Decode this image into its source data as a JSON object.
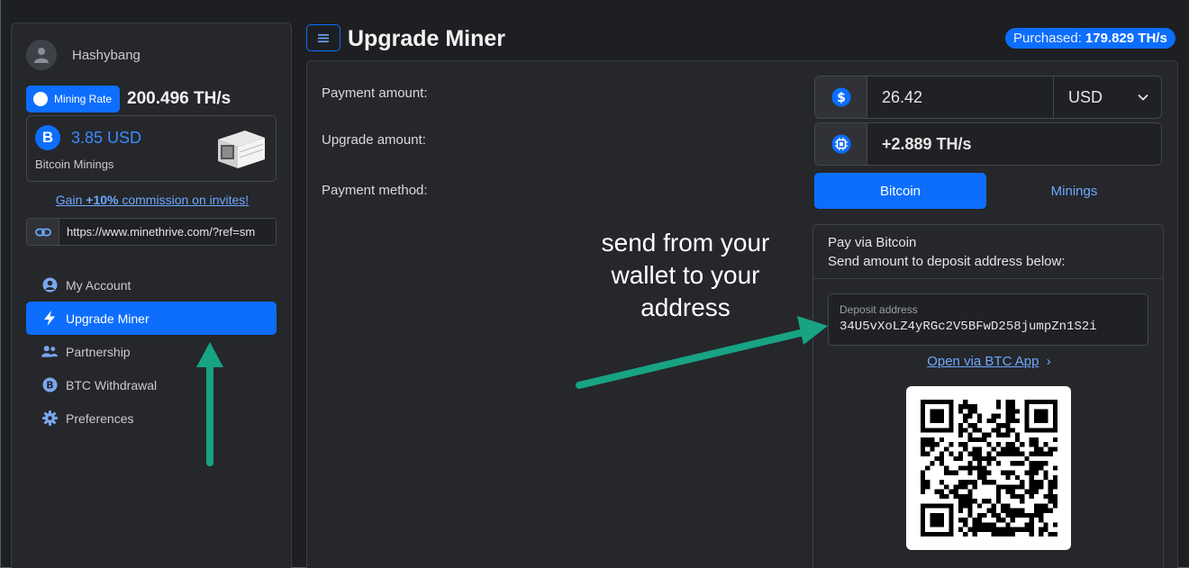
{
  "sidebar": {
    "username": "Hashybang",
    "mining_rate_label": "Mining Rate",
    "mining_rate_value": "200.496 TH/s",
    "btc_amount": "3.85 USD",
    "btc_label": "Bitcoin Minings",
    "btc_symbol": "B",
    "invite_prefix": "Gain ",
    "invite_bold": "+10%",
    "invite_suffix": " commission on invites!",
    "referral_url": "https://www.minethrive.com/?ref=sm",
    "nav": [
      {
        "label": "My Account",
        "icon": "user-circle-icon"
      },
      {
        "label": "Upgrade Miner",
        "icon": "bolt-icon",
        "active": true
      },
      {
        "label": "Partnership",
        "icon": "users-icon"
      },
      {
        "label": "BTC Withdrawal",
        "icon": "bitcoin-icon"
      },
      {
        "label": "Preferences",
        "icon": "gear-icon"
      }
    ]
  },
  "header": {
    "title": "Upgrade Miner",
    "purchased_label": "Purchased:",
    "purchased_value": "179.829 TH/s"
  },
  "form": {
    "payment_amount_label": "Payment amount:",
    "payment_amount_value": "26.42",
    "currency": "USD",
    "upgrade_amount_label": "Upgrade amount:",
    "upgrade_amount_value": "+2.889 TH/s",
    "payment_method_label": "Payment method:",
    "methods": [
      "Bitcoin",
      "Minings"
    ]
  },
  "pay": {
    "title": "Pay via Bitcoin",
    "subtitle": "Send amount to deposit address below:",
    "deposit_label": "Deposit address",
    "deposit_address": "34U5vXoLZ4yRGc2V5BFwD258jumpZn1S2i",
    "open_app": "Open via BTC App",
    "open_app_chevron": "›"
  },
  "annotation": {
    "text": "send from your wallet to your address",
    "color": "#18a383"
  },
  "colors": {
    "accent": "#0d6efd",
    "link": "#6ea8fe",
    "background": "#1d1f22",
    "card": "#25272b"
  }
}
